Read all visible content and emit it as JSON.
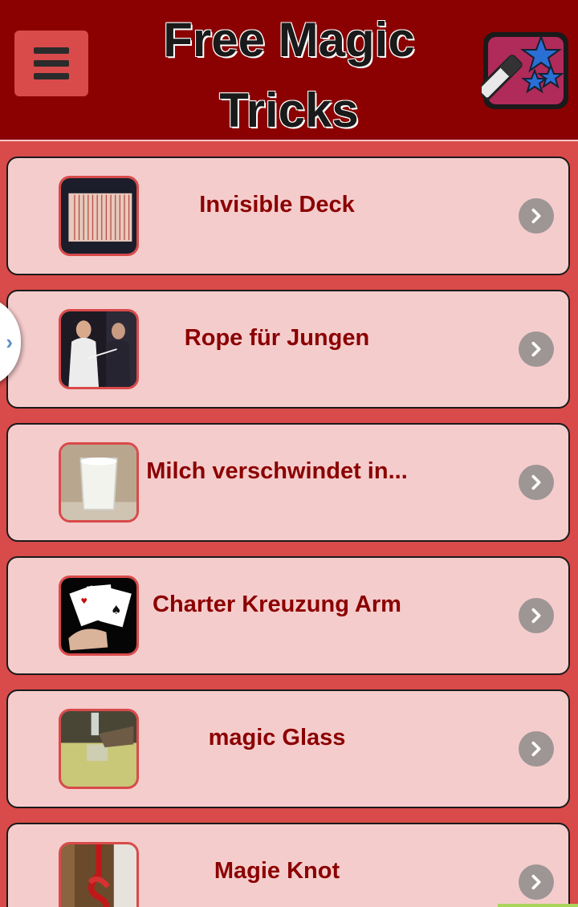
{
  "header": {
    "title": "Free Magic\nTricks",
    "menu_icon": "hamburger-menu-icon",
    "logo_icon": "magic-wand-stars-icon",
    "bg_color": "#8b0000"
  },
  "side_tab": {
    "icon": "chevron-right-icon",
    "glyph": "›"
  },
  "list": {
    "items": [
      {
        "label": "Invisible Deck",
        "thumb": "cards-deck-thumbnail"
      },
      {
        "label": "Rope für Jungen",
        "thumb": "magicians-rope-thumbnail"
      },
      {
        "label": "Milch verschwindet in...",
        "thumb": "milk-glass-thumbnail"
      },
      {
        "label": "Charter Kreuzung Arm",
        "thumb": "playing-cards-hand-thumbnail"
      },
      {
        "label": "magic Glass",
        "thumb": "glass-on-table-thumbnail"
      },
      {
        "label": "Magie Knot",
        "thumb": "rope-knot-thumbnail"
      }
    ]
  },
  "colors": {
    "background": "#d94a4a",
    "card": "#f5cccc",
    "label": "#8b0000",
    "chevron": "#9e9595"
  }
}
